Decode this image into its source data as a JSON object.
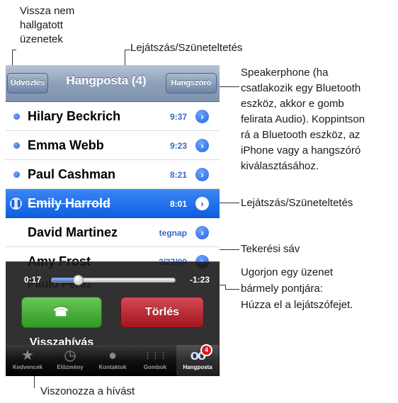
{
  "phone": {
    "navbar": {
      "back_label": "Üdvözlés",
      "title": "Hangposta (4)",
      "speaker_label": "Hangszóró"
    },
    "rows": [
      {
        "name": "Hilary Beckrich",
        "time": "9:37",
        "unheard": true
      },
      {
        "name": "Emma Webb",
        "time": "9:23",
        "unheard": true
      },
      {
        "name": "Paul Cashman",
        "time": "8:21",
        "unheard": true
      },
      {
        "name": "Emily Harrold",
        "time": "8:01",
        "selected": true,
        "playing": true
      },
      {
        "name": "David Martinez",
        "time": "tegnap"
      },
      {
        "name": "Amy Frost",
        "time": "2/27/09"
      }
    ],
    "hidden_row_name": "Paulo Perez",
    "player": {
      "elapsed": "0:17",
      "remaining": "-1:23",
      "progress": 0.17,
      "callback_label": "Visszahívás",
      "delete_label": "Törlés"
    },
    "tabs": [
      {
        "label": "Kedvencek",
        "icon": "star-icon"
      },
      {
        "label": "Előzmény",
        "icon": "clock-icon"
      },
      {
        "label": "Kontaktok",
        "icon": "contact-icon"
      },
      {
        "label": "Gombok",
        "icon": "keypad-icon"
      },
      {
        "label": "Hangposta",
        "icon": "voicemail-icon",
        "active": true,
        "badge": "4"
      }
    ]
  },
  "annotations": {
    "unheard": "Vissza nem\nhallgatott\nüzenetek",
    "play_pause_top": "Lejátszás/Szüneteltetés",
    "speakerphone": "Speakerphone (ha\ncsatlakozik egy Bluetooth\neszköz, akkor e gomb\nfelirata Audio). Koppintson\nrá a Bluetooth eszköz, az\niPhone vagy a hangszóró\nkiválasztásához.",
    "play_pause_right": "Lejátszás/Szüneteltetés",
    "scrub_bar": "Tekerési sáv",
    "scrub_help": "Ugorjon egy üzenet\nbármely pontjára:\nHúzza el a lejátszófejet.",
    "callback": "Viszonozza a hívást"
  },
  "colors": {
    "accent": "#2566e0",
    "callback_green": "#2f9a22",
    "delete_red": "#a3141e"
  }
}
